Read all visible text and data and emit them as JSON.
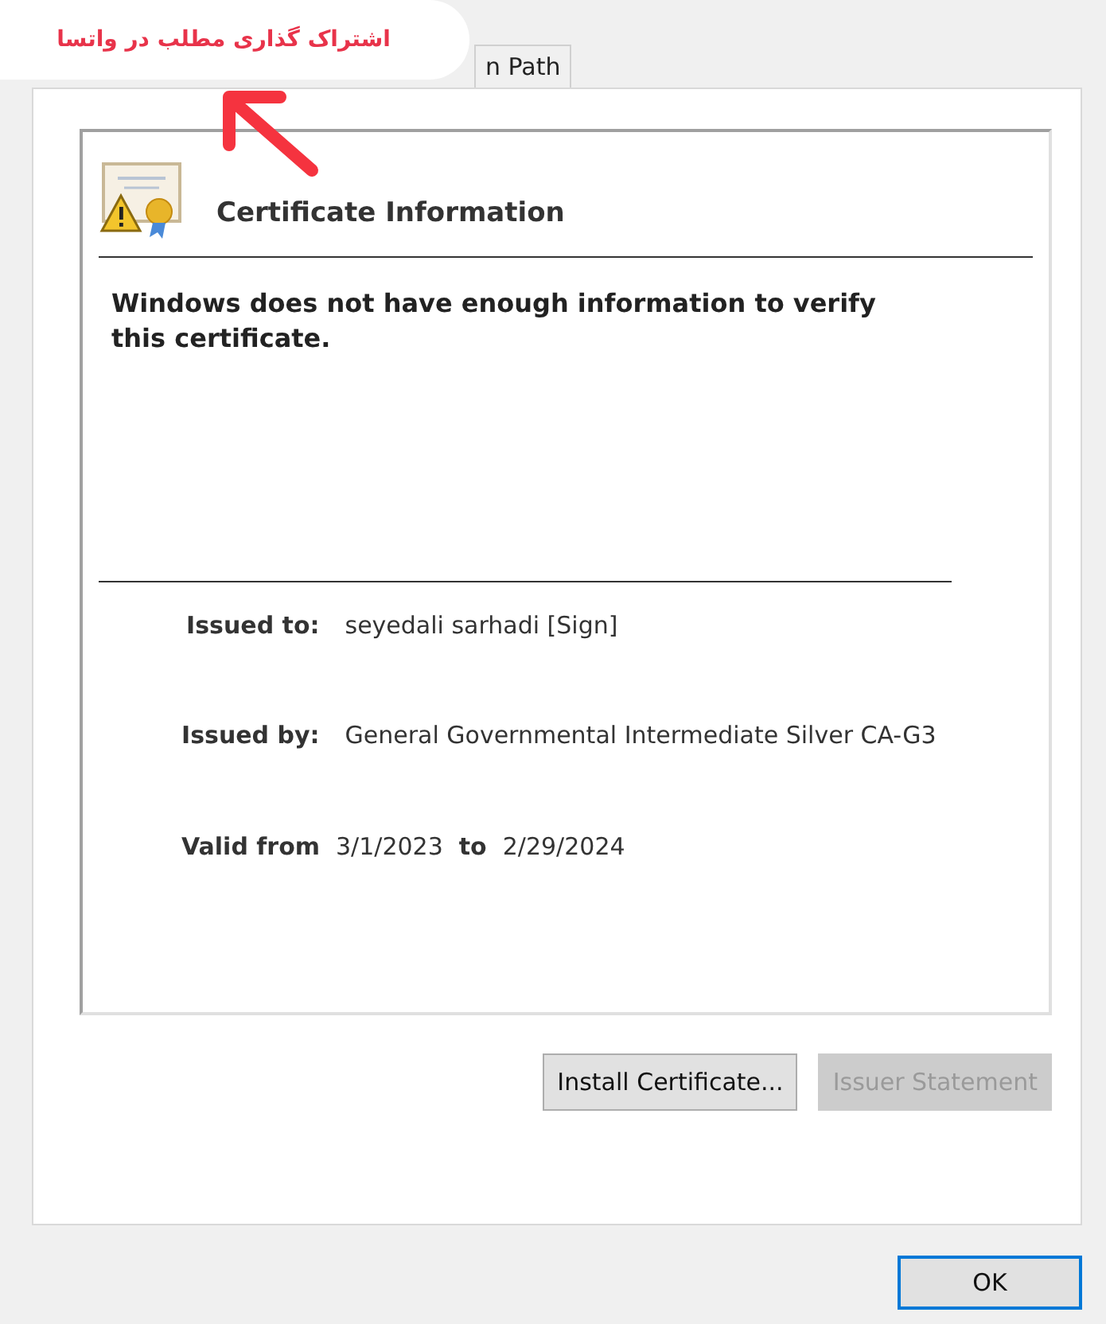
{
  "overlay": {
    "share_label": "اشتراک گذاری مطلب در واتسا"
  },
  "tabs": [
    {
      "label": "n Path",
      "selected": false
    }
  ],
  "certificate_info": {
    "heading": "Certificate Information",
    "message": "Windows does not have enough information to verify this certificate."
  },
  "fields": [
    {
      "label": "Issued to:",
      "value": "seyedali sarhadi [Sign]"
    },
    {
      "label": "Issued by:",
      "value": "General Governmental Intermediate Silver CA-G3"
    }
  ],
  "validity": {
    "label": "Valid from",
    "from": "3/1/2023",
    "to_label": "to",
    "to": "2/29/2024"
  },
  "buttons": [
    {
      "label": "Install Certificate...",
      "disabled": false
    },
    {
      "label": "Issuer Statement",
      "disabled": true
    }
  ],
  "footer": {
    "ok": "OK"
  }
}
